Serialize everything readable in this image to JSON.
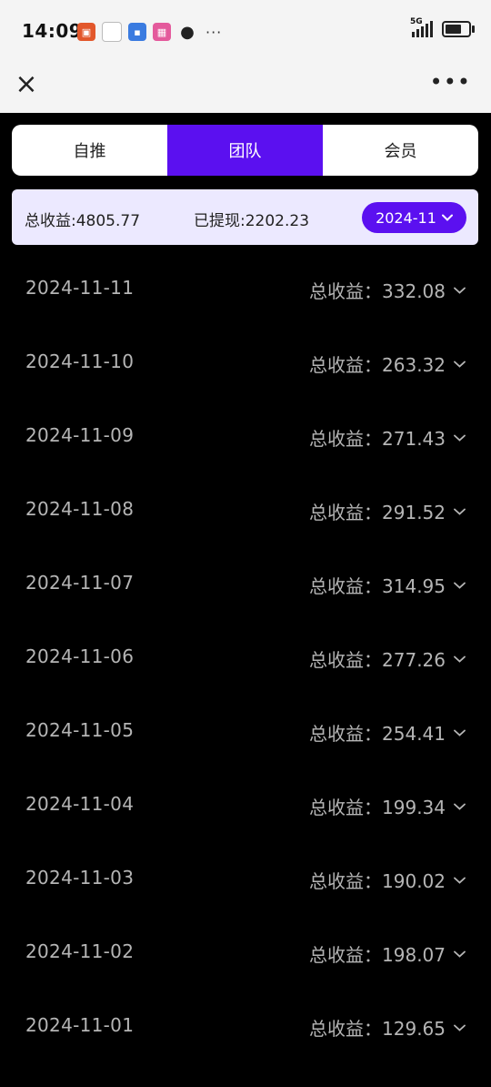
{
  "status_bar": {
    "time": "14:09",
    "network": "5G",
    "more_glyph": "···",
    "notification_icons": [
      "app-notification-icon",
      "app-notification-icon",
      "app-notification-icon",
      "app-notification-icon",
      "wechat-icon"
    ]
  },
  "nav": {
    "close_glyph": "×",
    "more_glyph": "•••"
  },
  "tabs": [
    {
      "label": "自推",
      "active": false
    },
    {
      "label": "团队",
      "active": true
    },
    {
      "label": "会员",
      "active": false
    }
  ],
  "summary": {
    "total_earnings": "总收益:4805.77",
    "withdrawn": "已提现:2202.23",
    "month": "2024-11"
  },
  "rows": [
    {
      "date": "2024-11-11",
      "earnings": "总收益：332.08"
    },
    {
      "date": "2024-11-10",
      "earnings": "总收益：263.32"
    },
    {
      "date": "2024-11-09",
      "earnings": "总收益：271.43"
    },
    {
      "date": "2024-11-08",
      "earnings": "总收益：291.52"
    },
    {
      "date": "2024-11-07",
      "earnings": "总收益：314.95"
    },
    {
      "date": "2024-11-06",
      "earnings": "总收益：277.26"
    },
    {
      "date": "2024-11-05",
      "earnings": "总收益：254.41"
    },
    {
      "date": "2024-11-04",
      "earnings": "总收益：199.34"
    },
    {
      "date": "2024-11-03",
      "earnings": "总收益：190.02"
    },
    {
      "date": "2024-11-02",
      "earnings": "总收益：198.07"
    },
    {
      "date": "2024-11-01",
      "earnings": "总收益：129.65"
    }
  ],
  "colors": {
    "accent": "#5b10f0",
    "summary_bg": "#ece9ff",
    "row_text": "#b5b5b5",
    "page_bg": "#000000"
  }
}
